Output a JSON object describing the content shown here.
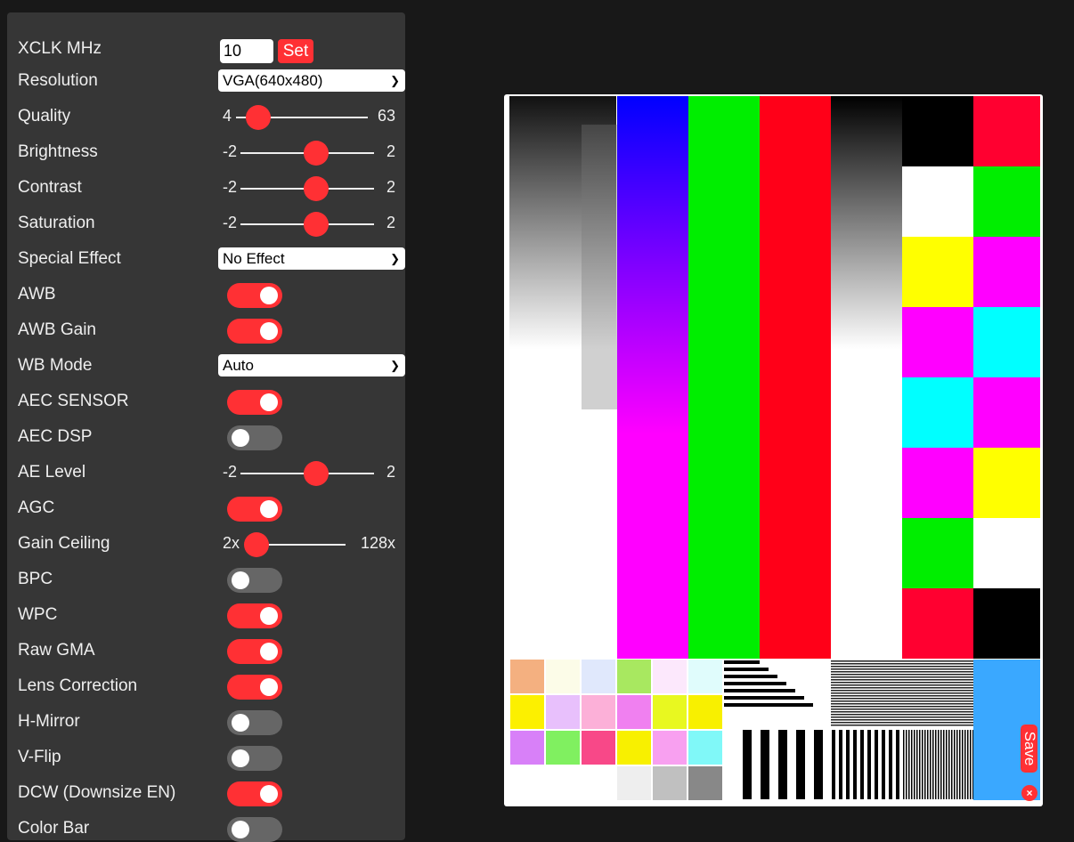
{
  "settings": {
    "xclk": {
      "label": "XCLK MHz",
      "value": "10",
      "button": "Set"
    },
    "resolution": {
      "label": "Resolution",
      "value": "VGA(640x480)"
    },
    "quality": {
      "label": "Quality",
      "min": "4",
      "max": "63",
      "value": 10
    },
    "brightness": {
      "label": "Brightness",
      "min": "-2",
      "max": "2",
      "value": 0
    },
    "contrast": {
      "label": "Contrast",
      "min": "-2",
      "max": "2",
      "value": 0
    },
    "saturation": {
      "label": "Saturation",
      "min": "-2",
      "max": "2",
      "value": 0
    },
    "special_effect": {
      "label": "Special Effect",
      "value": "No Effect"
    },
    "awb": {
      "label": "AWB",
      "on": true
    },
    "awb_gain": {
      "label": "AWB Gain",
      "on": true
    },
    "wb_mode": {
      "label": "WB Mode",
      "value": "Auto"
    },
    "aec_sensor": {
      "label": "AEC SENSOR",
      "on": true
    },
    "aec_dsp": {
      "label": "AEC DSP",
      "on": false
    },
    "ae_level": {
      "label": "AE Level",
      "min": "-2",
      "max": "2",
      "value": 0
    },
    "agc": {
      "label": "AGC",
      "on": true
    },
    "gain_ceiling": {
      "label": "Gain Ceiling",
      "min": "2x",
      "max": "128x",
      "value": "2x"
    },
    "bpc": {
      "label": "BPC",
      "on": false
    },
    "wpc": {
      "label": "WPC",
      "on": true
    },
    "raw_gma": {
      "label": "Raw GMA",
      "on": true
    },
    "lens_correction": {
      "label": "Lens Correction",
      "on": true
    },
    "hmirror": {
      "label": "H-Mirror",
      "on": false
    },
    "vflip": {
      "label": "V-Flip",
      "on": false
    },
    "dcw": {
      "label": "DCW (Downsize EN)",
      "on": true
    },
    "colorbar": {
      "label": "Color Bar",
      "on": false
    }
  },
  "stream": {
    "save_label": "Save",
    "close_label": "×"
  },
  "colors": {
    "accent": "#ff3034",
    "panel": "#363636",
    "background": "#181818"
  }
}
